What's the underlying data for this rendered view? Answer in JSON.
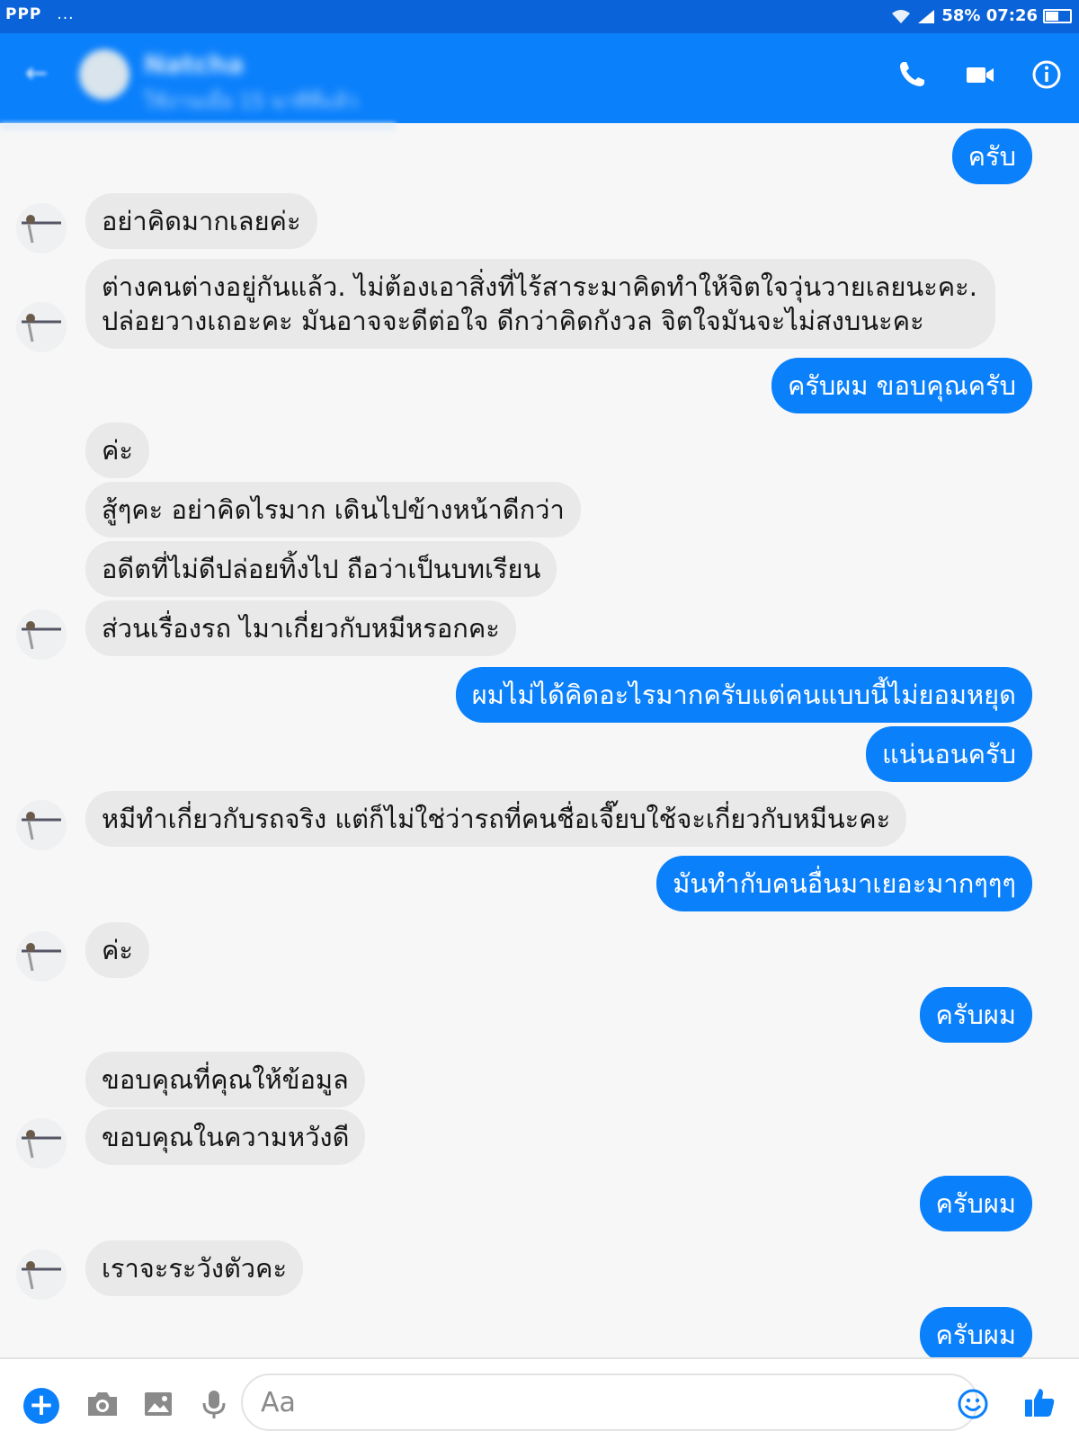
{
  "status_bar": {
    "left": "PPP",
    "dots": "...",
    "right": "58% 07:26"
  },
  "header": {
    "back_glyph": "←",
    "contact_name": "Natcha",
    "contact_status": "ใช้งานเมื่อ 15 นาทีที่แล้ว"
  },
  "accent_color": "#0b80fb",
  "messages": [
    {
      "dir": "out",
      "text": "ครับ"
    },
    {
      "dir": "in",
      "text": "อย่าคิดมากเลยค่ะ"
    },
    {
      "dir": "in",
      "text": "ต่างคนต่างอยู่กันแล้ว. ไม่ต้องเอาสิ่งที่ไร้สาระมาคิดทำให้จิตใจวุ่นวายเลยนะคะ. ปล่อยวางเถอะคะ มันอาจจะดีต่อใจ ดีกว่าคิดกังวล จิตใจมันจะไม่สงบนะคะ"
    },
    {
      "dir": "out",
      "text": "ครับผม ขอบคุณครับ"
    },
    {
      "dir": "in",
      "text": "ค่ะ"
    },
    {
      "dir": "in",
      "text": "สู้ๆคะ อย่าคิดไรมาก เดินไปข้างหน้าดีกว่า"
    },
    {
      "dir": "in",
      "text": "อดีตที่ไม่ดีปล่อยทิ้งไป ถือว่าเป็นบทเรียน"
    },
    {
      "dir": "in",
      "text": "ส่วนเรื่องรถ ไมาเกี่ยวกับหมีหรอกคะ"
    },
    {
      "dir": "out",
      "text": "ผมไม่ได้คิดอะไรมากครับแต่คนแบบนี้ไม่ยอมหยุด"
    },
    {
      "dir": "out",
      "text": "แน่นอนครับ"
    },
    {
      "dir": "in",
      "text": "หมีทำเกี่ยวกับรถจริง แต่ก็ไม่ใช่ว่ารถที่คนชื่อเจี๊ยบใช้จะเกี่ยวกับหมีนะคะ"
    },
    {
      "dir": "out",
      "text": "มันทำกับคนอื่นมาเยอะมากๆๆๆ"
    },
    {
      "dir": "in",
      "text": "ค่ะ"
    },
    {
      "dir": "out",
      "text": "ครับผม"
    },
    {
      "dir": "in",
      "text": "ขอบคุณที่คุณให้ข้อมูล"
    },
    {
      "dir": "in",
      "text": "ขอบคุณในความหวังดี"
    },
    {
      "dir": "out",
      "text": "ครับผม"
    },
    {
      "dir": "in",
      "text": "เราจะระวังตัวคะ"
    },
    {
      "dir": "out",
      "text": "ครับผม"
    }
  ],
  "composer": {
    "placeholder": "Aa",
    "plus_glyph": "+"
  }
}
